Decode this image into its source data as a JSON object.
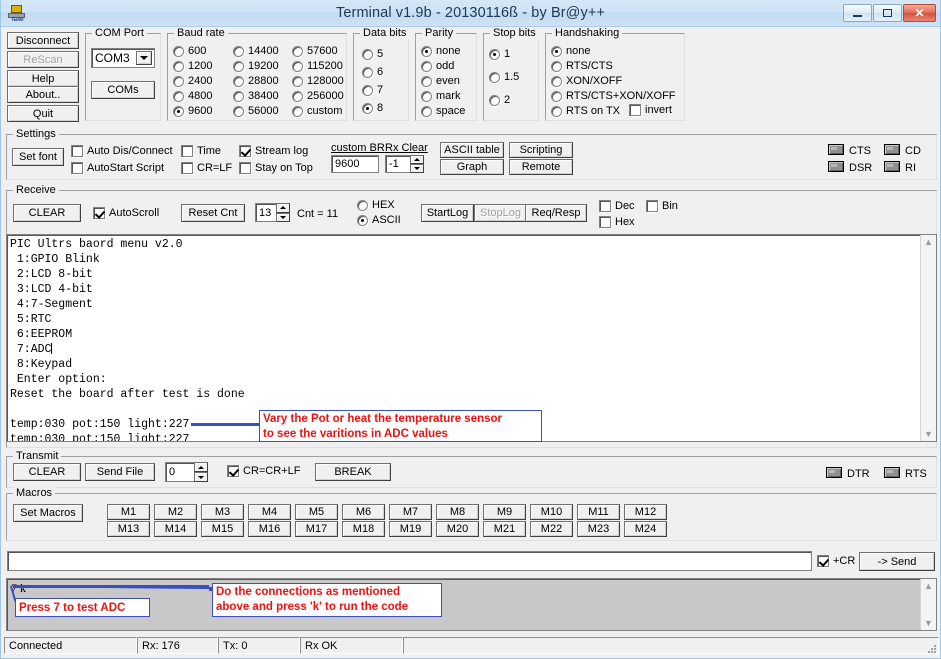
{
  "window": {
    "title": "Terminal v1.9b - 20130116ß - by Br@y++",
    "icon": "terminal-icon",
    "minimize_label": "Minimize",
    "maximize_label": "Maximize",
    "close_label": "Close"
  },
  "left_buttons": [
    {
      "label": "Disconnect",
      "disabled": false
    },
    {
      "label": "ReScan",
      "disabled": true
    },
    {
      "label": "Help",
      "disabled": false
    },
    {
      "label": "About..",
      "disabled": false
    },
    {
      "label": "Quit",
      "disabled": false
    }
  ],
  "com_port": {
    "legend": "COM Port",
    "selected": "COM3",
    "coms_button": "COMs"
  },
  "baud_rate": {
    "legend": "Baud rate",
    "selected": "9600",
    "col1": [
      "600",
      "1200",
      "2400",
      "4800",
      "9600"
    ],
    "col2": [
      "14400",
      "19200",
      "28800",
      "38400",
      "56000"
    ],
    "col3": [
      "57600",
      "115200",
      "128000",
      "256000",
      "custom"
    ]
  },
  "data_bits": {
    "legend": "Data bits",
    "selected": "8",
    "options": [
      "5",
      "6",
      "7",
      "8"
    ]
  },
  "parity": {
    "legend": "Parity",
    "selected": "none",
    "options": [
      "none",
      "odd",
      "even",
      "mark",
      "space"
    ]
  },
  "stop_bits": {
    "legend": "Stop bits",
    "selected": "1",
    "options": [
      "1",
      "1.5",
      "2"
    ]
  },
  "handshaking": {
    "legend": "Handshaking",
    "selected": "none",
    "options": [
      "none",
      "RTS/CTS",
      "XON/XOFF",
      "RTS/CTS+XON/XOFF",
      "RTS on TX"
    ],
    "invert_label": "invert",
    "invert_checked": false
  },
  "settings": {
    "legend": "Settings",
    "set_font_button": "Set font",
    "auto_dis_connect": {
      "label": "Auto Dis/Connect",
      "checked": false
    },
    "autostart_script": {
      "label": "AutoStart Script",
      "checked": false
    },
    "time": {
      "label": "Time",
      "checked": false
    },
    "cr_lf": {
      "label": "CR=LF",
      "checked": false
    },
    "stream_log": {
      "label": "Stream log",
      "checked": true
    },
    "stay_on_top": {
      "label": "Stay on Top",
      "checked": false
    },
    "custom_br_label": "custom BR",
    "custom_br_value": "9600",
    "rx_clear_label": "Rx Clear",
    "rx_clear_value": "-1",
    "ascii_table_button": "ASCII table",
    "scripting_button": "Scripting",
    "graph_button": "Graph",
    "remote_button": "Remote",
    "leds": [
      "CTS",
      "CD",
      "DSR",
      "RI"
    ]
  },
  "receive": {
    "legend": "Receive",
    "clear_button": "CLEAR",
    "autoscroll": {
      "label": "AutoScroll",
      "checked": true
    },
    "reset_cnt_button": "Reset Cnt",
    "cnt_field_value": "13",
    "cnt_label": "Cnt = 11",
    "hex_radio": "HEX",
    "ascii_radio": "ASCII",
    "format_selected": "ASCII",
    "startlog_button": "StartLog",
    "stoplog_button": "StopLog",
    "stoplog_disabled": true,
    "reqresp_button": "Req/Resp",
    "dec": {
      "label": "Dec",
      "checked": false
    },
    "hex": {
      "label": "Hex",
      "checked": false
    },
    "bin": {
      "label": "Bin",
      "checked": false
    },
    "text": "PIC Ultrs baord menu v2.0\n 1:GPIO Blink\n 2:LCD 8-bit\n 3:LCD 4-bit\n 4:7-Segment\n 5:RTC\n 6:EEPROM\n 7:ADC",
    "text_after": " 8:Keypad\n Enter option:\nReset the board after test is done\n\ntemp:030 pot:150 light:227\ntemp:030 pot:150 light:227"
  },
  "annotations": {
    "top": "Vary the Pot or heat the temperature sensor\nto see the varitions in ADC values",
    "bottom_left": "Press 7 to test ADC",
    "bottom_right": "Do the connections as mentioned\nabove and press 'k' to run the code",
    "color": "#f01010",
    "line_color": "#3b4fc0"
  },
  "transmit": {
    "legend": "Transmit",
    "clear_button": "CLEAR",
    "send_file_button": "Send File",
    "delay_value": "0",
    "cr_crlf": {
      "label": "CR=CR+LF",
      "checked": true
    },
    "break_button": "BREAK",
    "leds": [
      "DTR",
      "RTS"
    ]
  },
  "macros": {
    "legend": "Macros",
    "set_macros_button": "Set Macros",
    "row1": [
      "M1",
      "M2",
      "M3",
      "M4",
      "M5",
      "M6",
      "M7",
      "M8",
      "M9",
      "M10",
      "M11",
      "M12"
    ],
    "row2": [
      "M13",
      "M14",
      "M15",
      "M16",
      "M17",
      "M18",
      "M19",
      "M20",
      "M21",
      "M22",
      "M23",
      "M24"
    ]
  },
  "send_bar": {
    "input_value": "",
    "cr_checkbox": {
      "label": "+CR",
      "checked": true
    },
    "send_button": "-> Send"
  },
  "history": {
    "line": "7 k"
  },
  "status_bar": {
    "connection": "Connected",
    "rx": "Rx: 176",
    "tx": "Tx: 0",
    "state": "Rx OK",
    "extra": ""
  }
}
